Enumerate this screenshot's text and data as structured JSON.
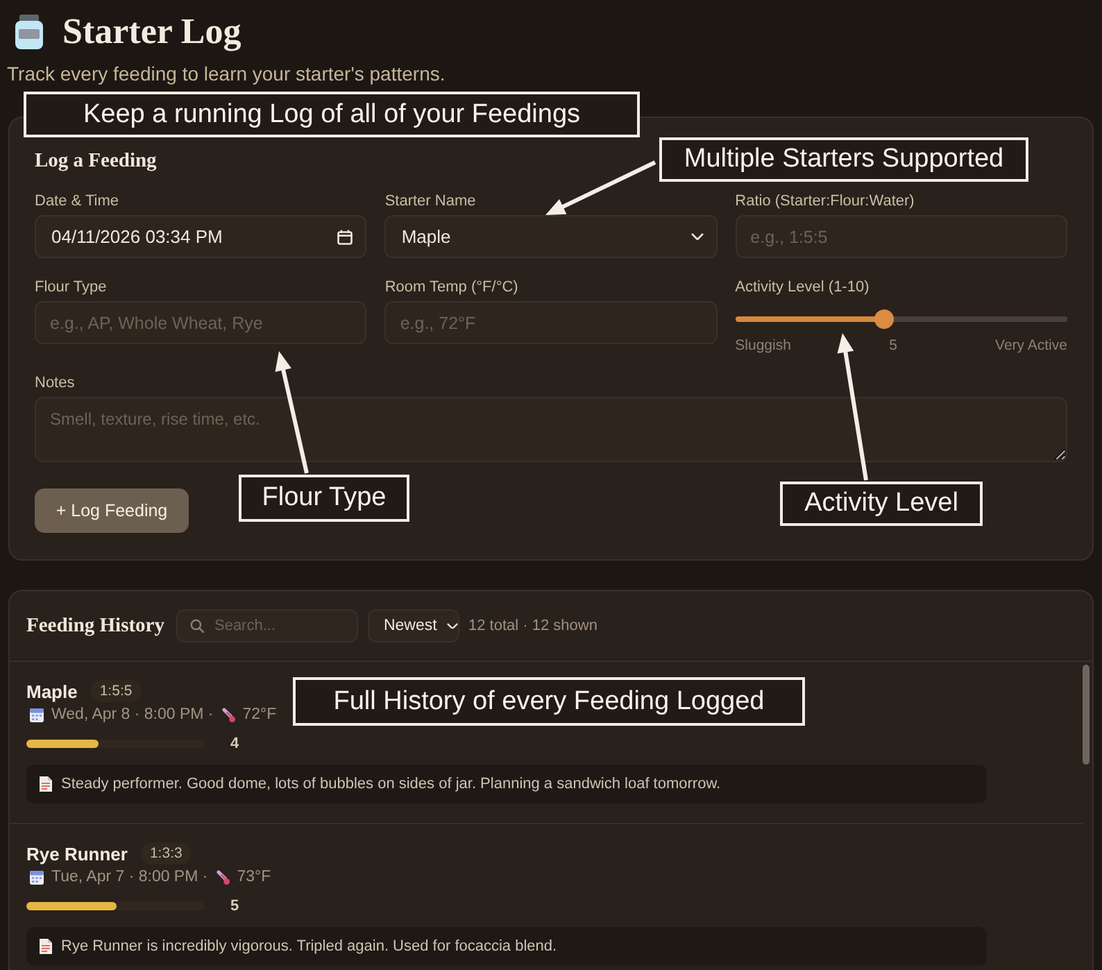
{
  "header": {
    "title": "Starter Log",
    "subtitle": "Track every feeding to learn your starter's patterns."
  },
  "log_form": {
    "title": "Log a Feeding",
    "fields": [
      {
        "kind": "datetime",
        "label": "Date & Time",
        "value": "04/11/2026 03:34 PM"
      },
      {
        "kind": "select",
        "label": "Starter Name",
        "value": "Maple"
      },
      {
        "kind": "text",
        "label": "Ratio (Starter:Flour:Water)",
        "placeholder": "e.g., 1:5:5"
      },
      {
        "kind": "text",
        "label": "Flour Type",
        "placeholder": "e.g., AP, Whole Wheat, Rye"
      },
      {
        "kind": "text",
        "label": "Room Temp (°F/°C)",
        "placeholder": "e.g., 72°F"
      },
      {
        "kind": "slider",
        "label": "Activity Level (1-10)",
        "level": 0.45,
        "min_label": "Sluggish",
        "reading": "5",
        "max_label": "Very Active"
      },
      {
        "kind": "textarea",
        "label": "Notes",
        "placeholder": "Smell, texture, rise time, etc."
      }
    ],
    "submit_button": "+ Log Feeding"
  },
  "history": {
    "title": "Feeding History",
    "search": {
      "placeholder": "Search..."
    },
    "sort": {
      "value": "Newest"
    },
    "count": "12 total · 12 shown",
    "entries": [
      {
        "name": "Maple",
        "ratio": "1:5:5",
        "date": "Wed, Apr 8 · 8:00 PM ·",
        "temp": "72°F",
        "level": 0.4,
        "activity": "4",
        "notes": "Steady performer. Good dome, lots of bubbles on sides of jar. Planning a sandwich loaf tomorrow."
      },
      {
        "name": "Rye Runner",
        "ratio": "1:3:3",
        "date": "Tue, Apr 7 · 8:00 PM ·",
        "temp": "73°F",
        "level": 0.5,
        "activity": "5",
        "notes": "Rye Runner is incredibly vigorous. Tripled again. Used for focaccia blend."
      }
    ]
  },
  "annotations": [
    {
      "text": "Keep a running Log of all of your Feedings",
      "arrow": false
    },
    {
      "text": "Multiple Starters Supported",
      "arrow": true
    },
    {
      "text": "Flour Type",
      "arrow": true
    },
    {
      "text": "Activity Level",
      "arrow": true
    },
    {
      "text": "Full History of every Feeding Logged",
      "arrow": false
    }
  ]
}
